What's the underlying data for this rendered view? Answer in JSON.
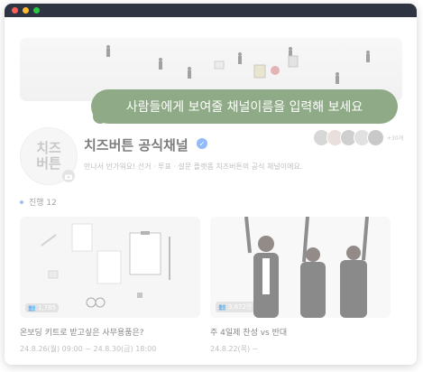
{
  "colors": {
    "tooltip_bg": "#8faa86",
    "verified": "#3b82f6",
    "status_dot": "#4a90e2"
  },
  "channel": {
    "avatar_text": "치즈버튼",
    "name": "치즈버튼 공식채널",
    "description": "만나서 반가워요! 선거 · 투표 · 설문 플랫폼 치즈버튼의 공식 채널이에요.",
    "subscriber_count": "+30개"
  },
  "tooltip": {
    "text": "사람들에게 보여줄 채널이름을 입력해 보세요"
  },
  "status": {
    "label": "진행 12"
  },
  "cards": [
    {
      "badge": "1,785",
      "title": "온보딩 키트로 받고싶은 사무용품은?",
      "date": "24.8.26(월) 09:00 ~ 24.8.30(금) 18:00"
    },
    {
      "badge": "3,672명",
      "title": "주 4일제 찬성 vs 반대",
      "date": "24.8.22(목) ~"
    }
  ]
}
